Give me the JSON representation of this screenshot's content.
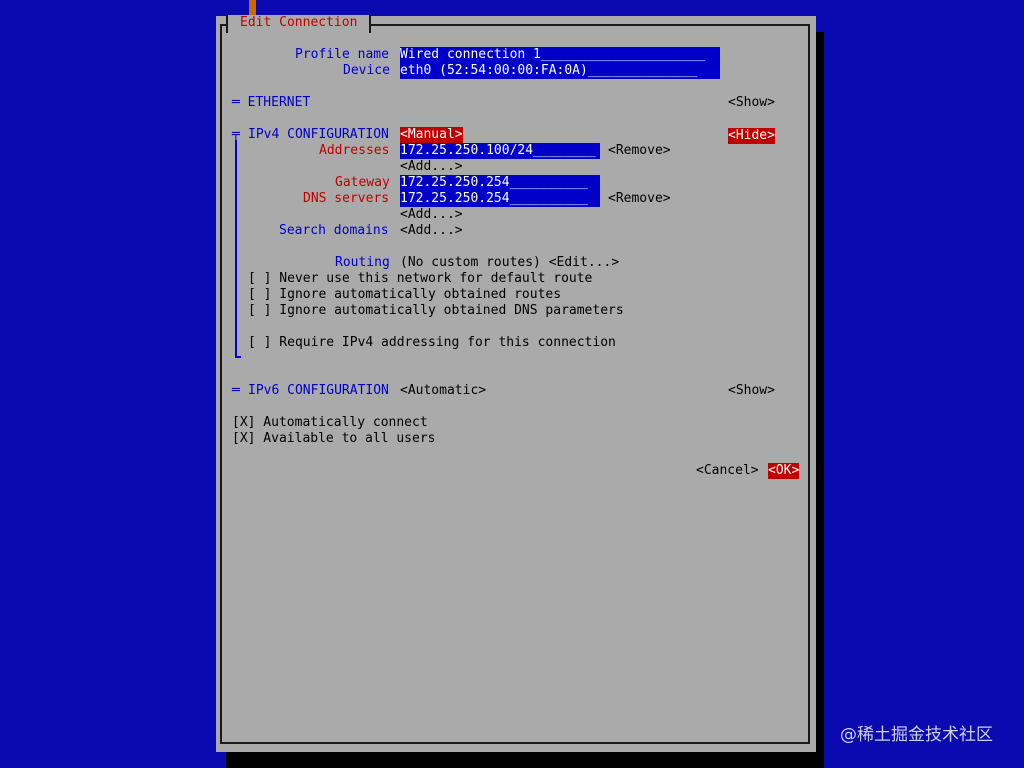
{
  "dialog": {
    "title": "Edit Connection",
    "profile_name_label": "Profile name",
    "profile_name_value": "Wired connection 1_____________________",
    "device_label": "Device",
    "device_value": "eth0 (52:54:00:00:FA:0A)______________",
    "ethernet_section": "═ ETHERNET",
    "ethernet_toggle": "<Show>",
    "ipv4": {
      "section_label": "IPv4 CONFIGURATION",
      "section_marker": "╤",
      "mode": "<Manual>",
      "toggle": "<Hide>",
      "addresses_label": "Addresses",
      "addresses_value": "172.25.250.100/24________",
      "addresses_remove": "<Remove>",
      "addresses_add": "<Add...>",
      "gateway_label": "Gateway",
      "gateway_value": "172.25.250.254__________",
      "dns_label": "DNS servers",
      "dns_value": "172.25.250.254__________",
      "dns_remove": "<Remove>",
      "dns_add": "<Add...>",
      "search_label": "Search domains",
      "search_add": "<Add...>",
      "routing_label": "Routing",
      "routing_value": "(No custom routes) <Edit...>",
      "opt_never_default": "[ ] Never use this network for default route",
      "opt_ignore_routes": "[ ] Ignore automatically obtained routes",
      "opt_ignore_dns": "[ ] Ignore automatically obtained DNS parameters",
      "opt_require_ipv4": "[ ] Require IPv4 addressing for this connection"
    },
    "ipv6": {
      "section_label": "IPv6 CONFIGURATION",
      "section_marker": "═",
      "mode": "<Automatic>",
      "toggle": "<Show>"
    },
    "auto_connect": "[X] Automatically connect",
    "all_users": "[X] Available to all users",
    "cancel": "<Cancel>",
    "ok": "<OK>"
  },
  "watermark": "@稀土掘金技术社区",
  "colors": {
    "background": "#0a0ab0",
    "dialog": "#aaaaaa",
    "accent_red": "#c00000",
    "label_blue": "#0000c8"
  }
}
